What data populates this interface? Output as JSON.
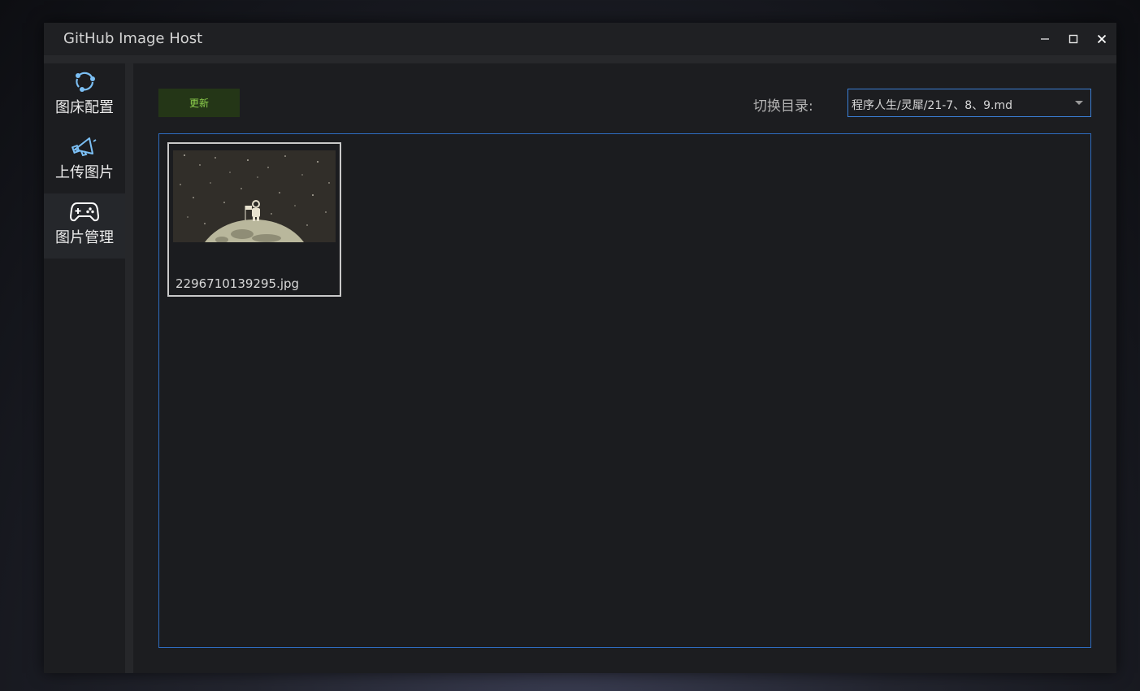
{
  "window": {
    "title": "GitHub Image Host",
    "controls": {
      "minimize": "minimize-icon",
      "maximize": "maximize-icon",
      "close": "close-icon"
    }
  },
  "sidebar": {
    "items": [
      {
        "label": "图床配置",
        "icon": "sync-icon",
        "active": false
      },
      {
        "label": "上传图片",
        "icon": "megaphone-icon",
        "active": false
      },
      {
        "label": "图片管理",
        "icon": "gamepad-icon",
        "active": true
      }
    ]
  },
  "toolbar": {
    "refresh_label": "更新",
    "dir_label": "切换目录:",
    "dir_value": "程序人生/灵犀/21-7、8、9.md"
  },
  "gallery": {
    "images": [
      {
        "name": "2296710139295.jpg"
      }
    ]
  },
  "colors": {
    "accent": "#3b7fd6",
    "icon": "#7cc0f5",
    "refresh_bg": "#243617",
    "refresh_text": "#8ed14d"
  }
}
